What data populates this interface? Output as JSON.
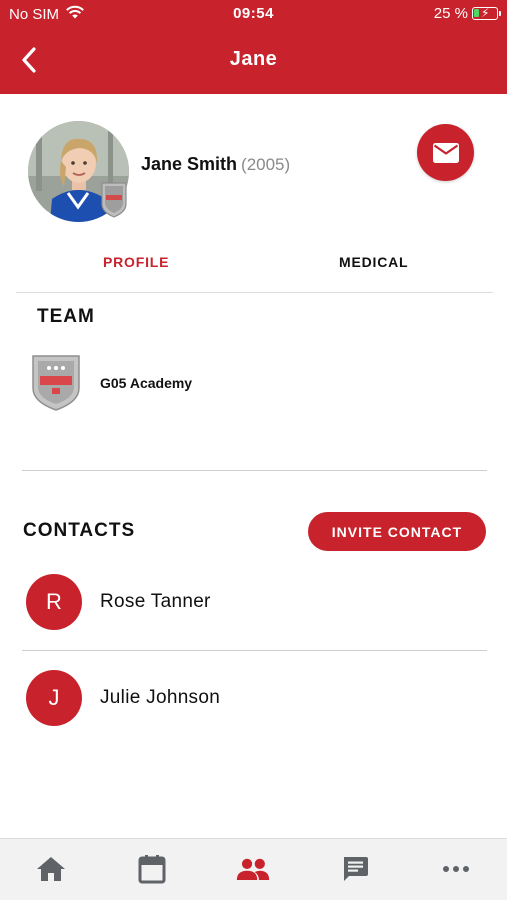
{
  "status_bar": {
    "carrier": "No SIM",
    "time": "09:54",
    "battery": "25 %",
    "battery_level": 0.25
  },
  "header": {
    "title": "Jane"
  },
  "profile": {
    "name": "Jane Smith",
    "year": "(2005)"
  },
  "tabs": [
    {
      "label": "PROFILE",
      "active": true
    },
    {
      "label": "MEDICAL",
      "active": false
    }
  ],
  "team": {
    "title": "TEAM",
    "items": [
      {
        "name": "G05 Academy"
      }
    ]
  },
  "contacts": {
    "title": "CONTACTS",
    "invite_label": "INVITE CONTACT",
    "items": [
      {
        "initial": "R",
        "name": "Rose Tanner"
      },
      {
        "initial": "J",
        "name": "Julie Johnson"
      }
    ]
  },
  "bottom_nav": [
    {
      "icon": "home-icon",
      "active": false
    },
    {
      "icon": "calendar-icon",
      "active": false
    },
    {
      "icon": "people-icon",
      "active": true
    },
    {
      "icon": "chat-icon",
      "active": false
    },
    {
      "icon": "more-icon",
      "active": false
    }
  ],
  "colors": {
    "accent": "#c8232c",
    "inactive_icon": "#5f6368",
    "tab_bar_bg": "#f2f2f2"
  }
}
